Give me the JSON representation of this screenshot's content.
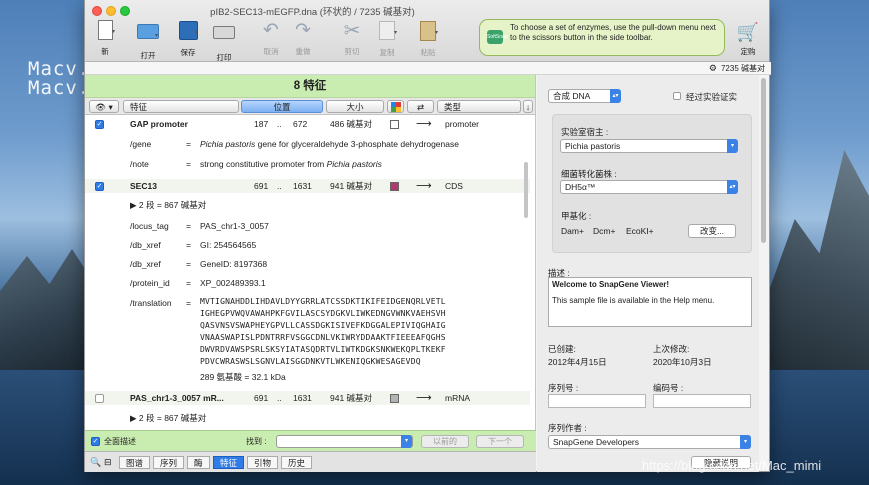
{
  "watermark": {
    "line1": "Macv.com",
    "line2": "Macv.com",
    "url": "https://blog.csdn.net/Mac_mimi"
  },
  "window": {
    "title": "pIB2-SEC13-mEGFP.dna  (环状的 / 7235 碱基对)"
  },
  "toolbar": {
    "new": "新",
    "open": "打开",
    "save": "保存",
    "print": "打印",
    "undo": "取消",
    "redo": "重做",
    "cut": "剪切",
    "copy": "复制",
    "paste": "粘贴",
    "tip": "To choose a set of enzymes, use the pull-down menu next to the scissors button in the side toolbar.",
    "tip_badge": "SoftSnap",
    "order": "定购"
  },
  "status": {
    "text": "7235 碱基对"
  },
  "features": {
    "header": "8 特征",
    "columns": {
      "feature": "特征",
      "location": "位置",
      "size": "大小",
      "type": "类型"
    },
    "rows": [
      {
        "name": "GAP promoter",
        "start": "187",
        "dots": "..",
        "end": "672",
        "size": "486 碱基对",
        "type": "promoter",
        "checked": true,
        "color": "#ffffff"
      },
      {
        "name": "SEC13",
        "start": "691",
        "dots": "..",
        "end": "1631",
        "size": "941 碱基对",
        "type": "CDS",
        "checked": true,
        "color": "#b03a6e"
      },
      {
        "name": "PAS_chr1-3_0057 mR...",
        "start": "691",
        "dots": "..",
        "end": "1631",
        "size": "941 碱基对",
        "type": "mRNA",
        "checked": false,
        "color": "#b3b3b3"
      }
    ],
    "gap_quals": {
      "gene_key": "/gene",
      "gene_it": "Pichia pastoris",
      "gene_rest": " gene for glyceraldehyde 3-phosphate dehydrogenase",
      "note_key": "/note",
      "note_rest": "strong constitutive promoter from ",
      "note_it": "Pichia pastoris"
    },
    "sec13_segments": "2 段  =  867 碱基对",
    "sec13_quals": [
      {
        "key": "/locus_tag",
        "value": "PAS_chr1-3_0057"
      },
      {
        "key": "/db_xref",
        "value": "GI: 254564565"
      },
      {
        "key": "/db_xref",
        "value": "GeneID: 8197368"
      },
      {
        "key": "/protein_id",
        "value": "XP_002489393.1"
      }
    ],
    "translation_key": "/translation",
    "translation": [
      "MVTIGNAHDDLIHDAVLDYYGRRLATCSSDKTIKIFEIDGENQRLVETL",
      "IGHEGPVWQVAWAHPKFGVILASCSYDGKVLIWKEDNGVWNKVAEHSVH",
      "QASVNSVSWAPHEYGPVLLCASSDGKISIVEFKDGGALEPIVIQGHAIG",
      "VNAASWAPISLPDNTRRFVSGGCDNLVKIWRYDDAAKTFIEEEAFQGHS",
      "DWVRDVAWSPSRLSKSYIATASQDRTVLIWTKDGKSNKWEKQPLTKEKF",
      "PDVCWRASWSLSGNVLAISGGDNKVTLWKENIQGKWESAGEVDQ"
    ],
    "aa_count": "289 氨基酸  =  32.1 kDa",
    "pas_segments": "2 段  =  867 碱基对"
  },
  "bottom": {
    "all_desc": "全面描述",
    "find": "找到 :",
    "prev": "以前的",
    "next": "下一个"
  },
  "tabs": [
    "图谱",
    "序列",
    "酶",
    "特征",
    "引物",
    "历史"
  ],
  "right": {
    "synth": "合成 DNA",
    "verified": "经过实验证实",
    "host_label": "实验室宿主 :",
    "host_value": "Pichia pastoris",
    "strain_label": "细菌转化菌株 :",
    "strain_value": "DH5α™",
    "meth_label": "甲基化 :",
    "meth_dam": "Dam+",
    "meth_dcm": "Dcm+",
    "meth_ecoki": "EcoKI+",
    "change_btn": "改变...",
    "desc_label": "描述 :",
    "desc_title": "Welcome to SnapGene Viewer!",
    "desc_body": "This sample file is available in the Help menu.",
    "created_label": "已创建:",
    "created_value": "2012年4月15日",
    "modified_label": "上次修改:",
    "modified_value": "2020年10月3日",
    "serial_label": "序列号 :",
    "code_label": "编码号 :",
    "author_label": "序列作者 :",
    "author_value": "SnapGene Developers",
    "footer_btn": "隐藏说明"
  }
}
